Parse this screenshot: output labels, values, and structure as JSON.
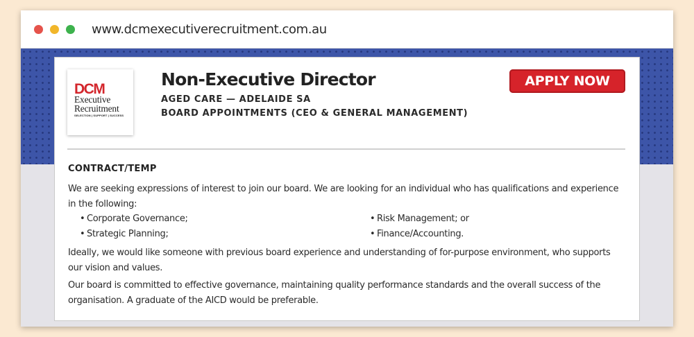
{
  "browser": {
    "url": "www.dcmexecutiverecruitment.com.au",
    "dots": [
      "#e5534b",
      "#f1b62a",
      "#3db24d"
    ]
  },
  "logo": {
    "brand": "DCM",
    "line1": "Executive",
    "line2": "Recruitment",
    "tagline": "SELECTION | SUPPORT | SUCCESS"
  },
  "job": {
    "title": "Non-Executive Director",
    "location": "AGED CARE — ADELAIDE SA",
    "category": "BOARD APPOINTMENTS (CEO & GENERAL MANAGEMENT)",
    "apply_label": "APPLY NOW",
    "type": "CONTRACT/TEMP",
    "intro": "We are seeking expressions of interest to join our board. We are looking for an individual who has qualifications and experience in the following:",
    "bullets_left": [
      "Corporate Governance;",
      "Strategic Planning;"
    ],
    "bullets_right": [
      "Risk Management; or",
      "Finance/Accounting."
    ],
    "para2": "Ideally, we would like someone with previous board experience and understanding of for-purpose environment, who supports our vision and values.",
    "para3": "Our board is committed to effective governance, maintaining quality performance standards and the overall success of the organisation. A graduate of the AICD would be preferable."
  },
  "colors": {
    "accent": "#d6232a",
    "banner": "#3d55a8",
    "page_bg": "#fbe9d2"
  }
}
